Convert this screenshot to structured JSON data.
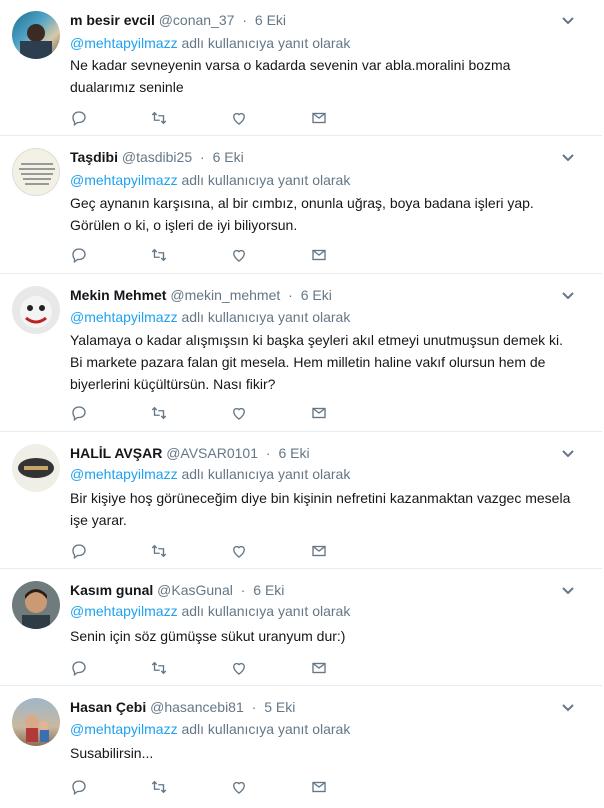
{
  "reply_prefix": "@mehtapyilmazz",
  "reply_suffix": "adlı kullanıcıya yanıt olarak",
  "icons": {
    "caret": "chevron-down-icon",
    "reply": "reply-icon",
    "retweet": "retweet-icon",
    "like": "heart-icon",
    "dm": "envelope-icon"
  },
  "colors": {
    "link": "#1da1f2",
    "muted": "#657786",
    "border": "#e6ecf0"
  },
  "tweets": [
    {
      "name": "m besir evcil",
      "handle": "@conan_37",
      "date": "6 Eki",
      "text": "Ne kadar sevneyenin varsa o kadarda sevenin var abla.moralini bozma dualarımız seninle"
    },
    {
      "name": "Taşdibi",
      "handle": "@tasdibi25",
      "date": "6 Eki",
      "text": "Geç aynanın karşısına, al bir cımbız, onunla uğraş, boya badana işleri yap. Görülen o ki, o işleri de iyi biliyorsun."
    },
    {
      "name": "Mekin Mehmet",
      "handle": "@mekin_mehmet",
      "date": "6 Eki",
      "text": "Yalamaya o kadar alışmışsın ki başka şeyleri akıl etmeyi unutmuşsun demek ki. Bi markete pazara falan git mesela. Hem milletin haline vakıf olursun hem de biyerlerini küçültürsün. Nası fikir?"
    },
    {
      "name": "HALİL AVŞAR",
      "handle": "@AVSAR0101",
      "date": "6 Eki",
      "text": "Bir kişiye hoş görüneceğim diye bin kişinin nefretini kazanmaktan vazgec mesela işe yarar."
    },
    {
      "name": "Kasım gunal",
      "handle": "@KasGunal",
      "date": "6 Eki",
      "text": "Senin için söz gümüşse sükut uranyum dur:)"
    },
    {
      "name": "Hasan Çebi",
      "handle": "@hasancebi81",
      "date": "5 Eki",
      "text": "Susabilirsin..."
    }
  ]
}
